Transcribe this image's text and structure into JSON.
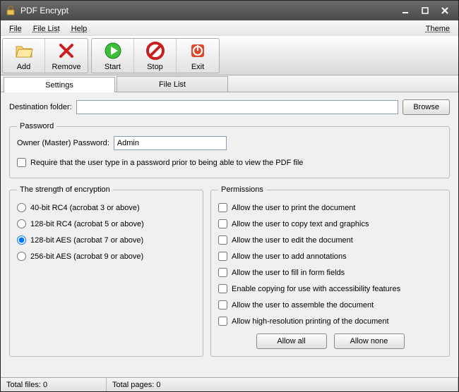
{
  "window": {
    "title": "PDF Encrypt"
  },
  "menu": {
    "file": "File",
    "filelist": "File List",
    "help": "Help",
    "theme": "Theme"
  },
  "toolbar": {
    "add": "Add",
    "remove": "Remove",
    "start": "Start",
    "stop": "Stop",
    "exit": "Exit"
  },
  "tabs": {
    "settings": "Settings",
    "filelist": "File List"
  },
  "dest": {
    "label": "Destination folder:",
    "value": "",
    "browse": "Browse"
  },
  "password": {
    "legend": "Password",
    "ownerLabel": "Owner (Master) Password:",
    "ownerValue": "Admin",
    "requireLabel": "Require that the user type in a password prior to being able to view the PDF file"
  },
  "encryption": {
    "legend": "The strength of encryption",
    "opt1": "40-bit RC4 (acrobat 3 or above)",
    "opt2": "128-bit RC4 (acrobat 5 or above)",
    "opt3": "128-bit AES (acrobat 7 or above)",
    "opt4": "256-bit AES (acrobat 9 or above)"
  },
  "permissions": {
    "legend": "Permissions",
    "p1": "Allow the user to print the document",
    "p2": "Allow the user to copy text and graphics",
    "p3": "Allow the user to edit the document",
    "p4": "Allow the user to add annotations",
    "p5": "Allow the user to fill in form fields",
    "p6": "Enable copying for use with accessibility features",
    "p7": "Allow the user to assemble the document",
    "p8": "Allow high-resolution printing of the document",
    "allowAll": "Allow all",
    "allowNone": "Allow none"
  },
  "status": {
    "totalFiles": "Total files: 0",
    "totalPages": "Total pages: 0"
  }
}
